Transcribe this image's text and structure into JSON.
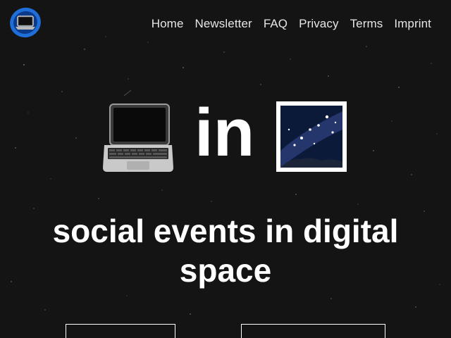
{
  "logo": {
    "icon": "laptop-globe-icon"
  },
  "nav": {
    "items": [
      {
        "label": "Home"
      },
      {
        "label": "Newsletter"
      },
      {
        "label": "FAQ"
      },
      {
        "label": "Privacy"
      },
      {
        "label": "Terms"
      },
      {
        "label": "Imprint"
      }
    ]
  },
  "hero": {
    "left_icon": "laptop-icon",
    "word": "in",
    "right_icon": "milky-way-icon"
  },
  "tagline": "social events in digital space",
  "colors": {
    "background": "#141414",
    "text": "#ffffff",
    "nav_text": "#e6e6e6",
    "logo_ring": "#1e6fd9"
  }
}
